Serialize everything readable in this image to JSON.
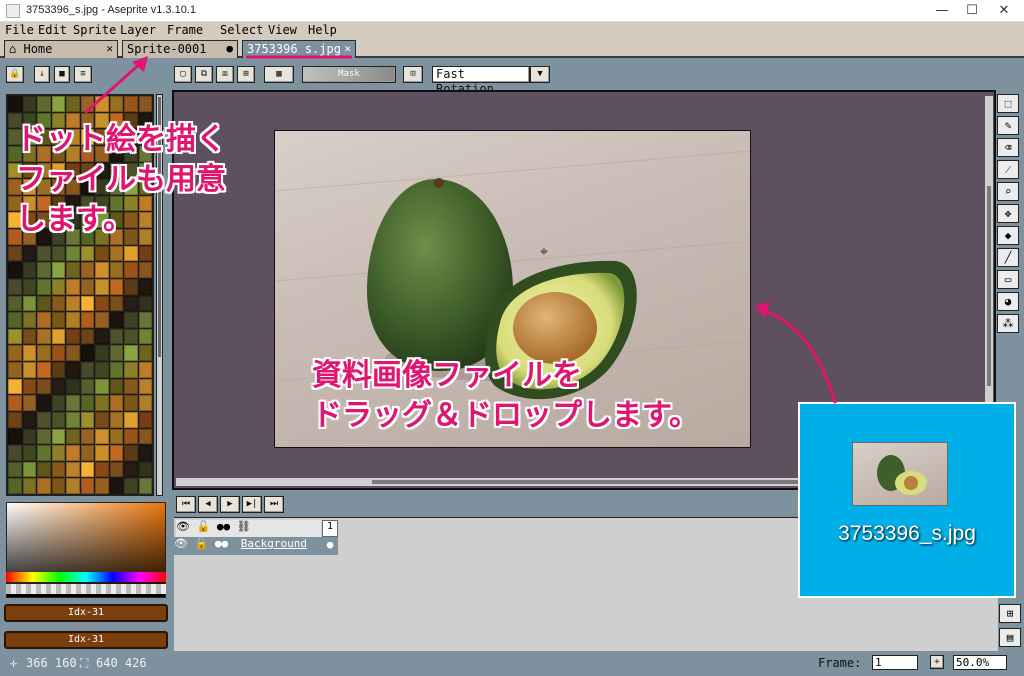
{
  "window": {
    "title": "3753396_s.jpg - Aseprite v1.3.10.1",
    "min": "—",
    "max": "☐",
    "close": "✕"
  },
  "menu": [
    "File",
    "Edit",
    "Sprite",
    "Layer",
    "Frame",
    "Select",
    "View",
    "Help"
  ],
  "tabs": [
    {
      "label": "Home",
      "icon": "home-icon",
      "close": "✕"
    },
    {
      "label": "Sprite-0001",
      "close": "●"
    },
    {
      "label": "3753396_s.jpg",
      "close": "✕"
    }
  ],
  "toolbar": {
    "mask_label": "Mask",
    "rotation": "Fast Rotation"
  },
  "timeline": {
    "frame_number": "1",
    "layer_name": "Background"
  },
  "color": {
    "fg_label": "Idx-31",
    "bg_label": "Idx-31"
  },
  "status": {
    "pos": "366 160",
    "size": "640 426",
    "frame_label": "Frame:",
    "frame_value": "1",
    "zoom": "50.0%"
  },
  "annotations": {
    "note1_line1": "ドット絵を描く",
    "note1_line2": "ファイルも用意",
    "note1_line3": "します。",
    "note2_line1": "資料画像ファイルを",
    "note2_line2": "ドラッグ＆ドロップします。"
  },
  "drag_file": {
    "name": "3753396_s.jpg"
  },
  "colors": {
    "accent": "#e0156f",
    "drag_bg": "#00aee8",
    "canvas_bg": "#5e505e",
    "ui_bg": "#7d929e"
  }
}
